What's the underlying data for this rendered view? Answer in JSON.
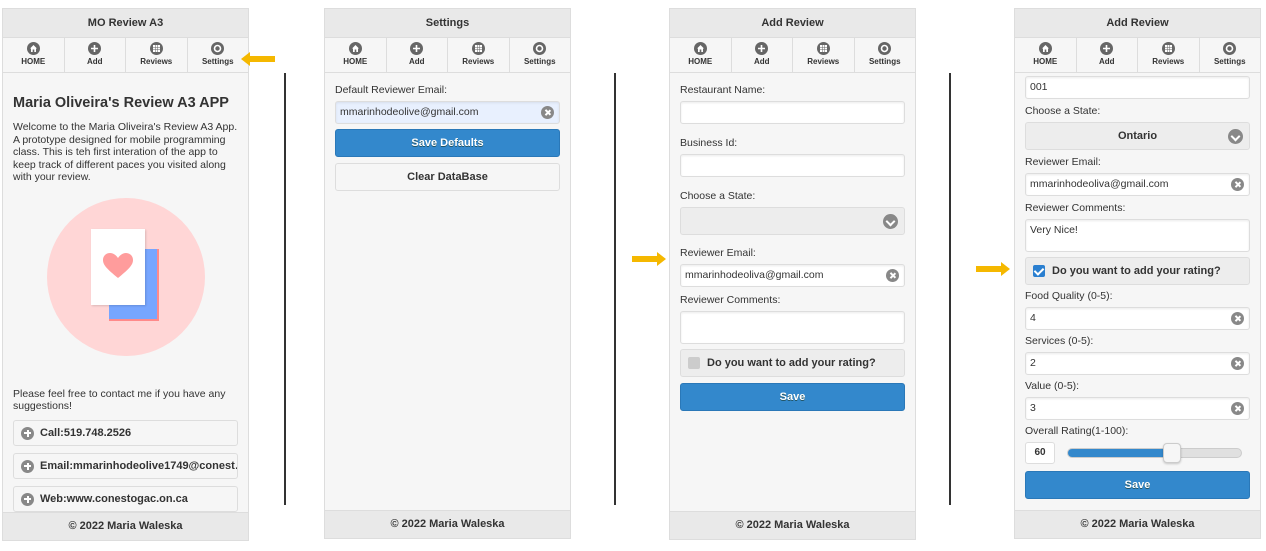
{
  "nav": {
    "home": "HOME",
    "add": "Add",
    "reviews": "Reviews",
    "settings": "Settings"
  },
  "footer": "© 2022 Maria Waleska",
  "colors": {
    "accent": "#3388cc",
    "arrow": "#f5b800",
    "illustration_bg": "#ffd6d6"
  },
  "screen1": {
    "title": "MO Review A3",
    "heading": "Maria Oliveira's Review A3 APP",
    "intro": "Welcome to the Maria Oliveira's Review A3 App. A prototype designed for mobile programming class. This is teh first interation of the app to keep track of different paces you visited along with your review.",
    "contact_text": "Please feel free to contact me if you have any suggestions!",
    "contacts": [
      "Call:519.748.2526",
      "Email:mmarinhodeolive1749@conest…",
      "Web:www.conestogac.on.ca"
    ]
  },
  "screen2": {
    "title": "Settings",
    "email_label": "Default Reviewer Email:",
    "email_value": "mmarinhodeolive@gmail.com",
    "save_label": "Save Defaults",
    "clear_label": "Clear DataBase"
  },
  "screen3": {
    "title": "Add Review",
    "restaurant_label": "Restaurant Name:",
    "restaurant_value": "",
    "business_label": "Business Id:",
    "business_value": "",
    "state_label": "Choose a State:",
    "state_value": "",
    "email_label": "Reviewer Email:",
    "email_value": "mmarinhodeoliva@gmail.com",
    "comments_label": "Reviewer Comments:",
    "comments_value": "",
    "rating_question": "Do you want to add your rating?",
    "rating_checked": false,
    "save_label": "Save"
  },
  "screen4": {
    "title": "Add Review",
    "business_value": "001",
    "state_label": "Choose a State:",
    "state_value": "Ontario",
    "email_label": "Reviewer Email:",
    "email_value": "mmarinhodeoliva@gmail.com",
    "comments_label": "Reviewer Comments:",
    "comments_value": "Very Nice!",
    "rating_question": "Do you want to add your rating?",
    "rating_checked": true,
    "food_label": "Food Quality (0-5):",
    "food_value": "4",
    "services_label": "Services (0-5):",
    "services_value": "2",
    "value_label": "Value (0-5):",
    "value_value": "3",
    "overall_label": "Overall Rating(1-100):",
    "overall_value": "60",
    "overall_fraction": 0.6,
    "save_label": "Save"
  }
}
